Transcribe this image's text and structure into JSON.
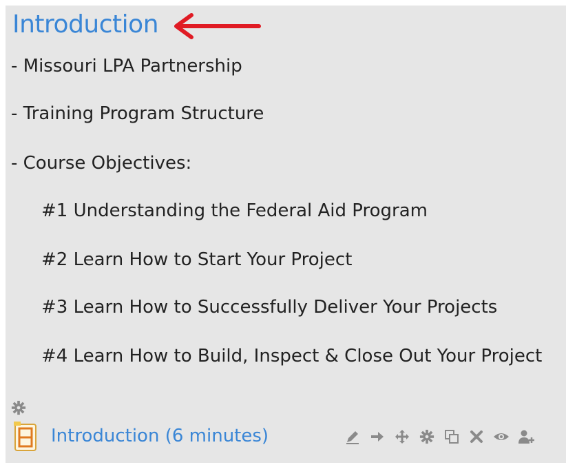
{
  "section": {
    "title": "Introduction",
    "items": [
      "- Missouri LPA Partnership",
      "- Training Program Structure",
      "- Course Objectives:"
    ],
    "objectives": [
      "#1 Understanding the Federal Aid Program",
      "#2 Learn How to Start Your Project",
      "#3 Learn How to Successfully Deliver Your Projects",
      "#4 Learn How to Build, Inspect & Close Out Your Project"
    ]
  },
  "activity": {
    "icon": "file-resource-icon",
    "label": "Introduction (6 minutes)"
  },
  "toolbar_icons": [
    "edit-icon",
    "move-right-icon",
    "move-icon",
    "settings-icon",
    "duplicate-icon",
    "delete-icon",
    "visibility-icon",
    "assign-roles-icon"
  ],
  "colors": {
    "panel_bg": "#e6e6e6",
    "heading": "#3a86d6",
    "link": "#3a86d6",
    "annotation_arrow": "#e01b24",
    "icon_gray": "#8a8a8a"
  }
}
